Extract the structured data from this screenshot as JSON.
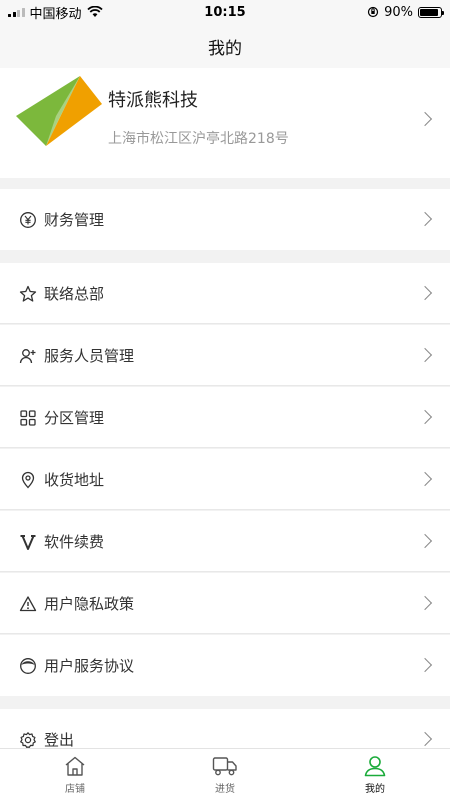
{
  "status": {
    "carrier": "中国移动",
    "time": "10:15",
    "battery": "90%",
    "battery_level": 0.9
  },
  "nav": {
    "title": "我的"
  },
  "profile": {
    "name": "特派熊科技",
    "address": "上海市松江区沪亭北路218号"
  },
  "menu": [
    {
      "label": "财务管理",
      "icon": "yuan-circle-icon"
    },
    {
      "label": "联络总部",
      "icon": "star-icon"
    },
    {
      "label": "服务人员管理",
      "icon": "user-add-icon"
    },
    {
      "label": "分区管理",
      "icon": "grid-icon"
    },
    {
      "label": "收货地址",
      "icon": "location-pin-icon"
    },
    {
      "label": "软件续费",
      "icon": "v-icon"
    },
    {
      "label": "用户隐私政策",
      "icon": "warning-triangle-icon"
    },
    {
      "label": "用户服务协议",
      "icon": "user-avatar-icon"
    },
    {
      "label": "登出",
      "icon": "gear-icon"
    }
  ],
  "tabs": [
    {
      "label": "店铺",
      "icon": "home-icon"
    },
    {
      "label": "进货",
      "icon": "truck-icon"
    },
    {
      "label": "我的",
      "icon": "profile-icon",
      "active": true
    }
  ],
  "colors": {
    "accent": "#1aab3a",
    "logo_green": "#7cb83c",
    "logo_orange": "#f0a000"
  }
}
